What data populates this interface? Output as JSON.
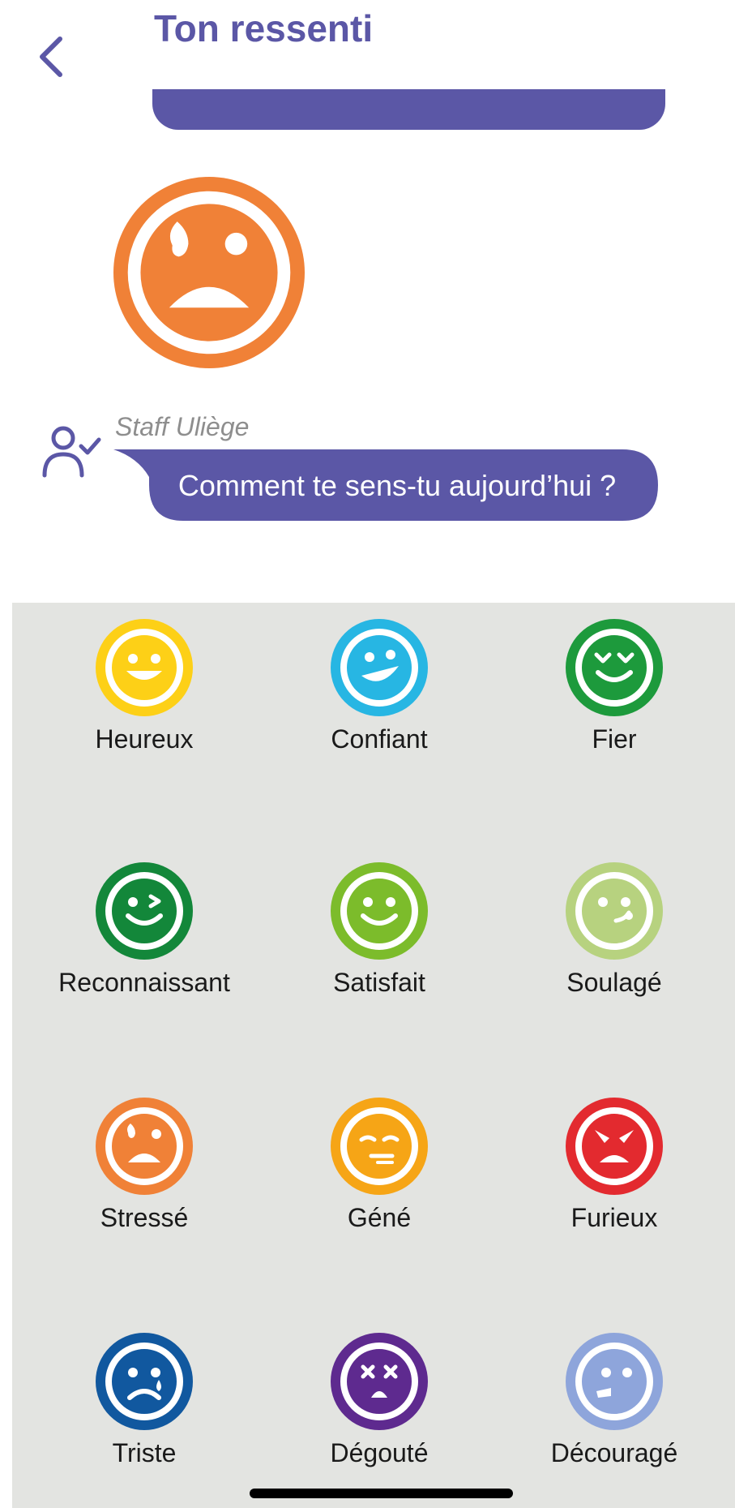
{
  "header": {
    "title": "Ton ressenti",
    "back_icon": "chevron-left-icon"
  },
  "selected_mood": {
    "icon": "stressed-face-icon",
    "color": "#f08137"
  },
  "message": {
    "sender": "Staff Uliège",
    "text": "Comment te sens-tu aujourd’hui ?",
    "bubble_color": "#5b57a6"
  },
  "moods": [
    {
      "label": "Heureux",
      "color": "#fdd017",
      "icon": "happy-face-icon"
    },
    {
      "label": "Confiant",
      "color": "#27b6e3",
      "icon": "confident-face-icon"
    },
    {
      "label": "Fier",
      "color": "#1d9a3c",
      "icon": "proud-face-icon"
    },
    {
      "label": "Reconnaissant",
      "color": "#13873a",
      "icon": "grateful-face-icon"
    },
    {
      "label": "Satisfait",
      "color": "#7cbc2b",
      "icon": "satisfied-face-icon"
    },
    {
      "label": "Soulagé",
      "color": "#b7d27f",
      "icon": "relieved-face-icon"
    },
    {
      "label": "Stressé",
      "color": "#f08137",
      "icon": "stressed-face-icon"
    },
    {
      "label": "Géné",
      "color": "#f6a516",
      "icon": "embarrassed-face-icon"
    },
    {
      "label": "Furieux",
      "color": "#e32a2f",
      "icon": "furious-face-icon"
    },
    {
      "label": "Triste",
      "color": "#11589f",
      "icon": "sad-face-icon"
    },
    {
      "label": "Dégouté",
      "color": "#5e2a8f",
      "icon": "disgusted-face-icon"
    },
    {
      "label": "Découragé",
      "color": "#8ea5db",
      "icon": "discouraged-face-icon"
    }
  ]
}
